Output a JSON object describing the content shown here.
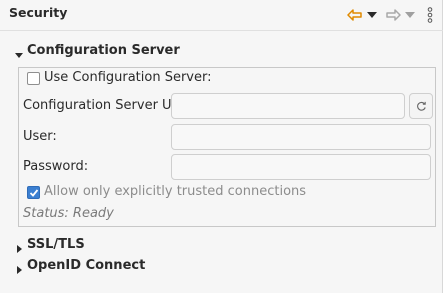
{
  "page": {
    "title": "Security"
  },
  "toolbar": {
    "back_icon": "arrow-left-icon",
    "back_menu_icon": "dropdown-triangle-icon",
    "forward_icon": "arrow-right-icon",
    "forward_menu_icon": "dropdown-triangle-icon",
    "more_icon": "more-vertical-icon"
  },
  "sections": {
    "config_server": {
      "label": "Configuration Server",
      "expanded": true,
      "use_server_label": "Use Configuration Server:",
      "use_server_checked": false,
      "url_label": "Configuration Server URL:",
      "url_value": "",
      "refresh_icon": "refresh-icon",
      "user_label": "User:",
      "user_value": "",
      "password_label": "Password:",
      "password_value": "",
      "trusted_label": "Allow only explicitly trusted connections",
      "trusted_checked": true,
      "status_text": "Status: Ready"
    },
    "ssl_tls": {
      "label": "SSL/TLS",
      "expanded": false
    },
    "openid": {
      "label": "OpenID Connect",
      "expanded": false
    }
  },
  "colors": {
    "accent": "#3b7fd1",
    "back_arrow": "#e08a00",
    "background": "#f6f6f6"
  }
}
